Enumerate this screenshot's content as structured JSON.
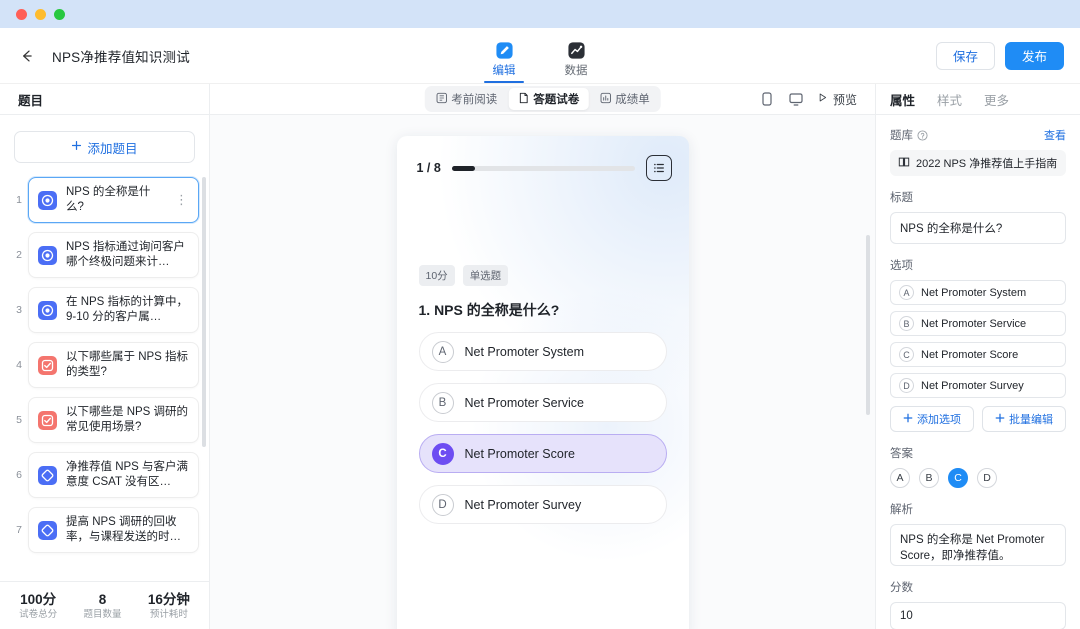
{
  "window": {
    "controls": [
      "close",
      "minimize",
      "zoom"
    ]
  },
  "header": {
    "back_icon": "arrow-left-icon",
    "title": "NPS净推荐值知识测试",
    "tabs": [
      {
        "label": "编辑",
        "icon": "edit-pencil-icon",
        "active": true
      },
      {
        "label": "数据",
        "icon": "chart-data-icon",
        "active": false
      }
    ],
    "save_label": "保存",
    "publish_label": "发布"
  },
  "sidebar": {
    "title": "题目",
    "add_label": "添加题目",
    "add_icon": "plus-icon",
    "questions": [
      {
        "num": "1",
        "text": "NPS 的全称是什么?",
        "type": "single",
        "selected": true,
        "more_icon": "more-vertical-icon"
      },
      {
        "num": "2",
        "text": "NPS 指标通过询问客户哪个终极问题来计…",
        "type": "single",
        "selected": false
      },
      {
        "num": "3",
        "text": "在 NPS 指标的计算中，9-10 分的客户属…",
        "type": "single",
        "selected": false
      },
      {
        "num": "4",
        "text": "以下哪些属于 NPS 指标的类型?",
        "type": "multi",
        "selected": false
      },
      {
        "num": "5",
        "text": "以下哪些是 NPS 调研的常见使用场景?",
        "type": "multi",
        "selected": false
      },
      {
        "num": "6",
        "text": "净推荐值 NPS 与客户满意度 CSAT 没有区…",
        "type": "judge",
        "selected": false
      },
      {
        "num": "7",
        "text": "提高 NPS 调研的回收率，与课程发送的时…",
        "type": "judge",
        "selected": false
      }
    ],
    "stats": [
      {
        "value": "100分",
        "label": "试卷总分"
      },
      {
        "value": "8",
        "label": "题目数量"
      },
      {
        "value": "16分钟",
        "label": "预计耗时"
      }
    ]
  },
  "center": {
    "segments": [
      {
        "label": "考前阅读",
        "icon": "book-read-icon",
        "active": false
      },
      {
        "label": "答题试卷",
        "icon": "paper-icon",
        "active": true
      },
      {
        "label": "成绩单",
        "icon": "report-icon",
        "active": false
      }
    ],
    "device_icons": [
      "mobile-icon",
      "desktop-icon"
    ],
    "preview_label": "预览",
    "preview_icon": "play-icon",
    "phone": {
      "counter": "1 / 8",
      "progress_percent": 12.5,
      "list_icon": "list-icon",
      "badges": [
        "10分",
        "单选题"
      ],
      "question": "1. NPS 的全称是什么?",
      "options": [
        {
          "key": "A",
          "text": "Net Promoter System",
          "selected": false
        },
        {
          "key": "B",
          "text": "Net Promoter Service",
          "selected": false
        },
        {
          "key": "C",
          "text": "Net Promoter Score",
          "selected": true
        },
        {
          "key": "D",
          "text": "Net Promoter Survey",
          "selected": false
        }
      ]
    }
  },
  "right": {
    "tabs": [
      {
        "label": "属性",
        "active": true
      },
      {
        "label": "样式",
        "active": false
      },
      {
        "label": "更多",
        "active": false
      }
    ],
    "bank_label": "题库",
    "bank_help_icon": "question-circle-icon",
    "bank_view_label": "查看",
    "bank_item": {
      "icon": "book-icon",
      "text": "2022 NPS 净推荐值上手指南"
    },
    "title_label": "标题",
    "title_value": "NPS 的全称是什么?",
    "options_label": "选项",
    "options": [
      {
        "key": "A",
        "text": "Net Promoter System"
      },
      {
        "key": "B",
        "text": "Net Promoter Service"
      },
      {
        "key": "C",
        "text": "Net Promoter Score"
      },
      {
        "key": "D",
        "text": "Net Promoter Survey"
      }
    ],
    "add_option_label": "添加选项",
    "batch_edit_label": "批量编辑",
    "answer_label": "答案",
    "answer_keys": [
      "A",
      "B",
      "C",
      "D"
    ],
    "answer_selected": "C",
    "analysis_label": "解析",
    "analysis_value": "NPS 的全称是 Net Promoter Score，即净推荐值。",
    "score_label": "分数",
    "score_value": "10"
  },
  "colors": {
    "accent_blue": "#1f8cf5",
    "link_blue": "#1f6fe0",
    "selected_purple": "#6d4df2",
    "titlebar": "#d3e3f8"
  }
}
